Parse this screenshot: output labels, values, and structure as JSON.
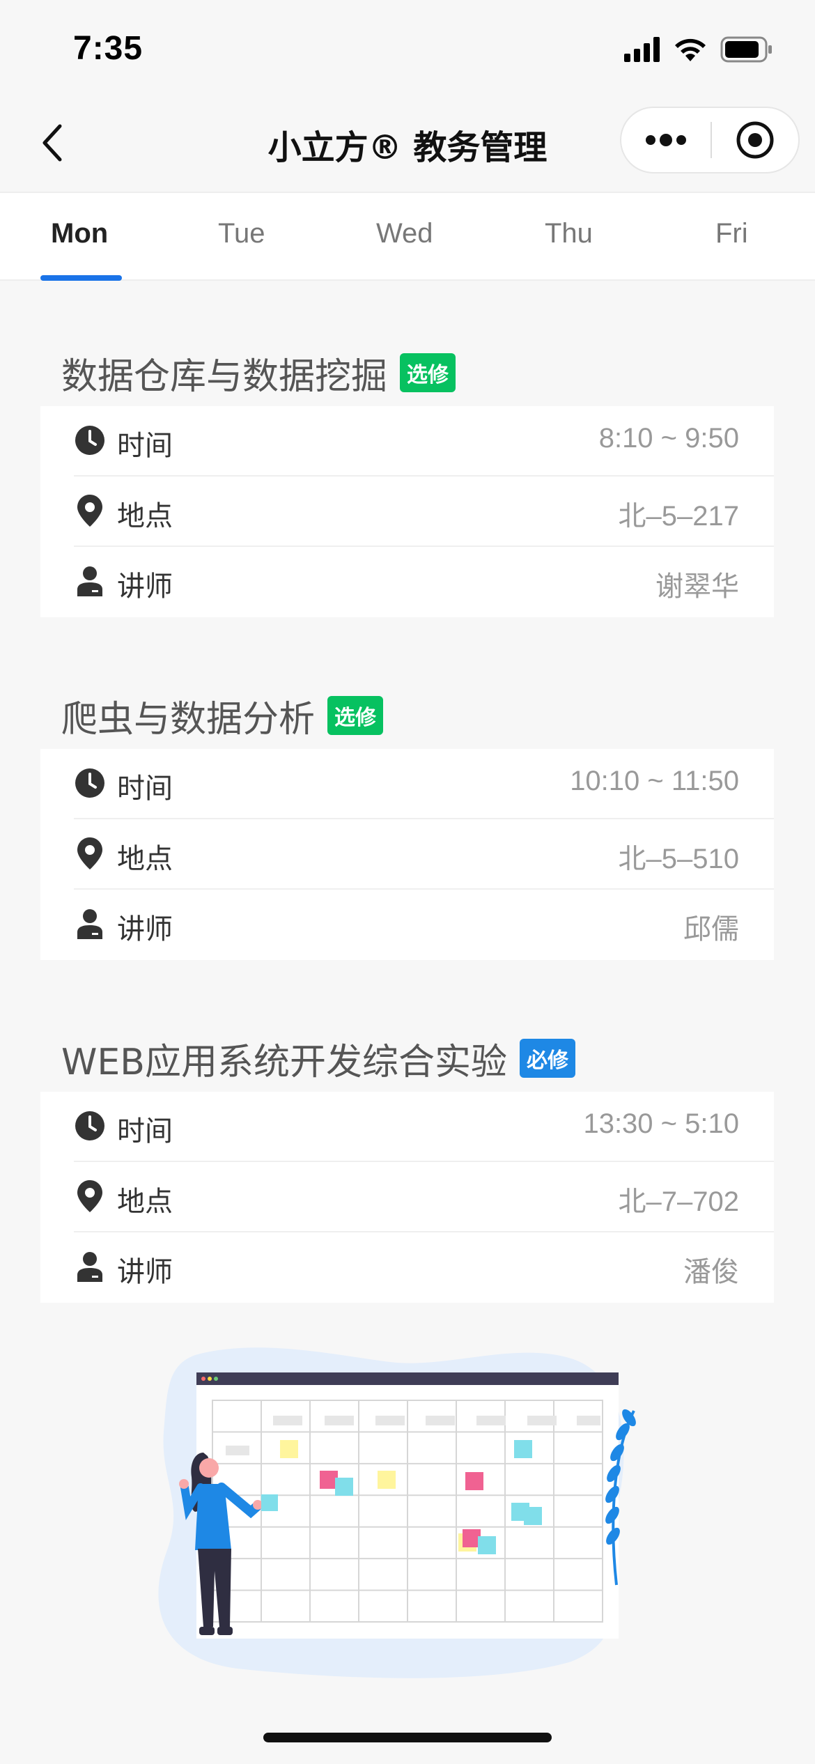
{
  "status_bar": {
    "time": "7:35"
  },
  "nav": {
    "title": "小立方® 教务管理"
  },
  "tabs": [
    {
      "label": "Mon",
      "active": true
    },
    {
      "label": "Tue",
      "active": false
    },
    {
      "label": "Wed",
      "active": false
    },
    {
      "label": "Thu",
      "active": false
    },
    {
      "label": "Fri",
      "active": false
    }
  ],
  "row_labels": {
    "time": "时间",
    "location": "地点",
    "teacher": "讲师"
  },
  "courses": [
    {
      "name": "数据仓库与数据挖掘",
      "badge": "选修",
      "badge_color": "#07c160",
      "time": "8:10 ~ 9:50",
      "location": "北–5–217",
      "teacher": "谢翠华"
    },
    {
      "name": "爬虫与数据分析",
      "badge": "选修",
      "badge_color": "#07c160",
      "time": "10:10 ~ 11:50",
      "location": "北–5–510",
      "teacher": "邱儒"
    },
    {
      "name": "WEB应用系统开发综合实验",
      "badge": "必修",
      "badge_color": "#1e88e5",
      "time": "13:30 ~ 5:10",
      "location": "北–7–702",
      "teacher": "潘俊"
    }
  ],
  "colors": {
    "accent": "#1a73e8",
    "elective": "#07c160",
    "required": "#1e88e5"
  },
  "icons": [
    "back-chevron-icon",
    "more-dots-icon",
    "target-close-icon",
    "clock-icon",
    "location-pin-icon",
    "person-icon"
  ]
}
